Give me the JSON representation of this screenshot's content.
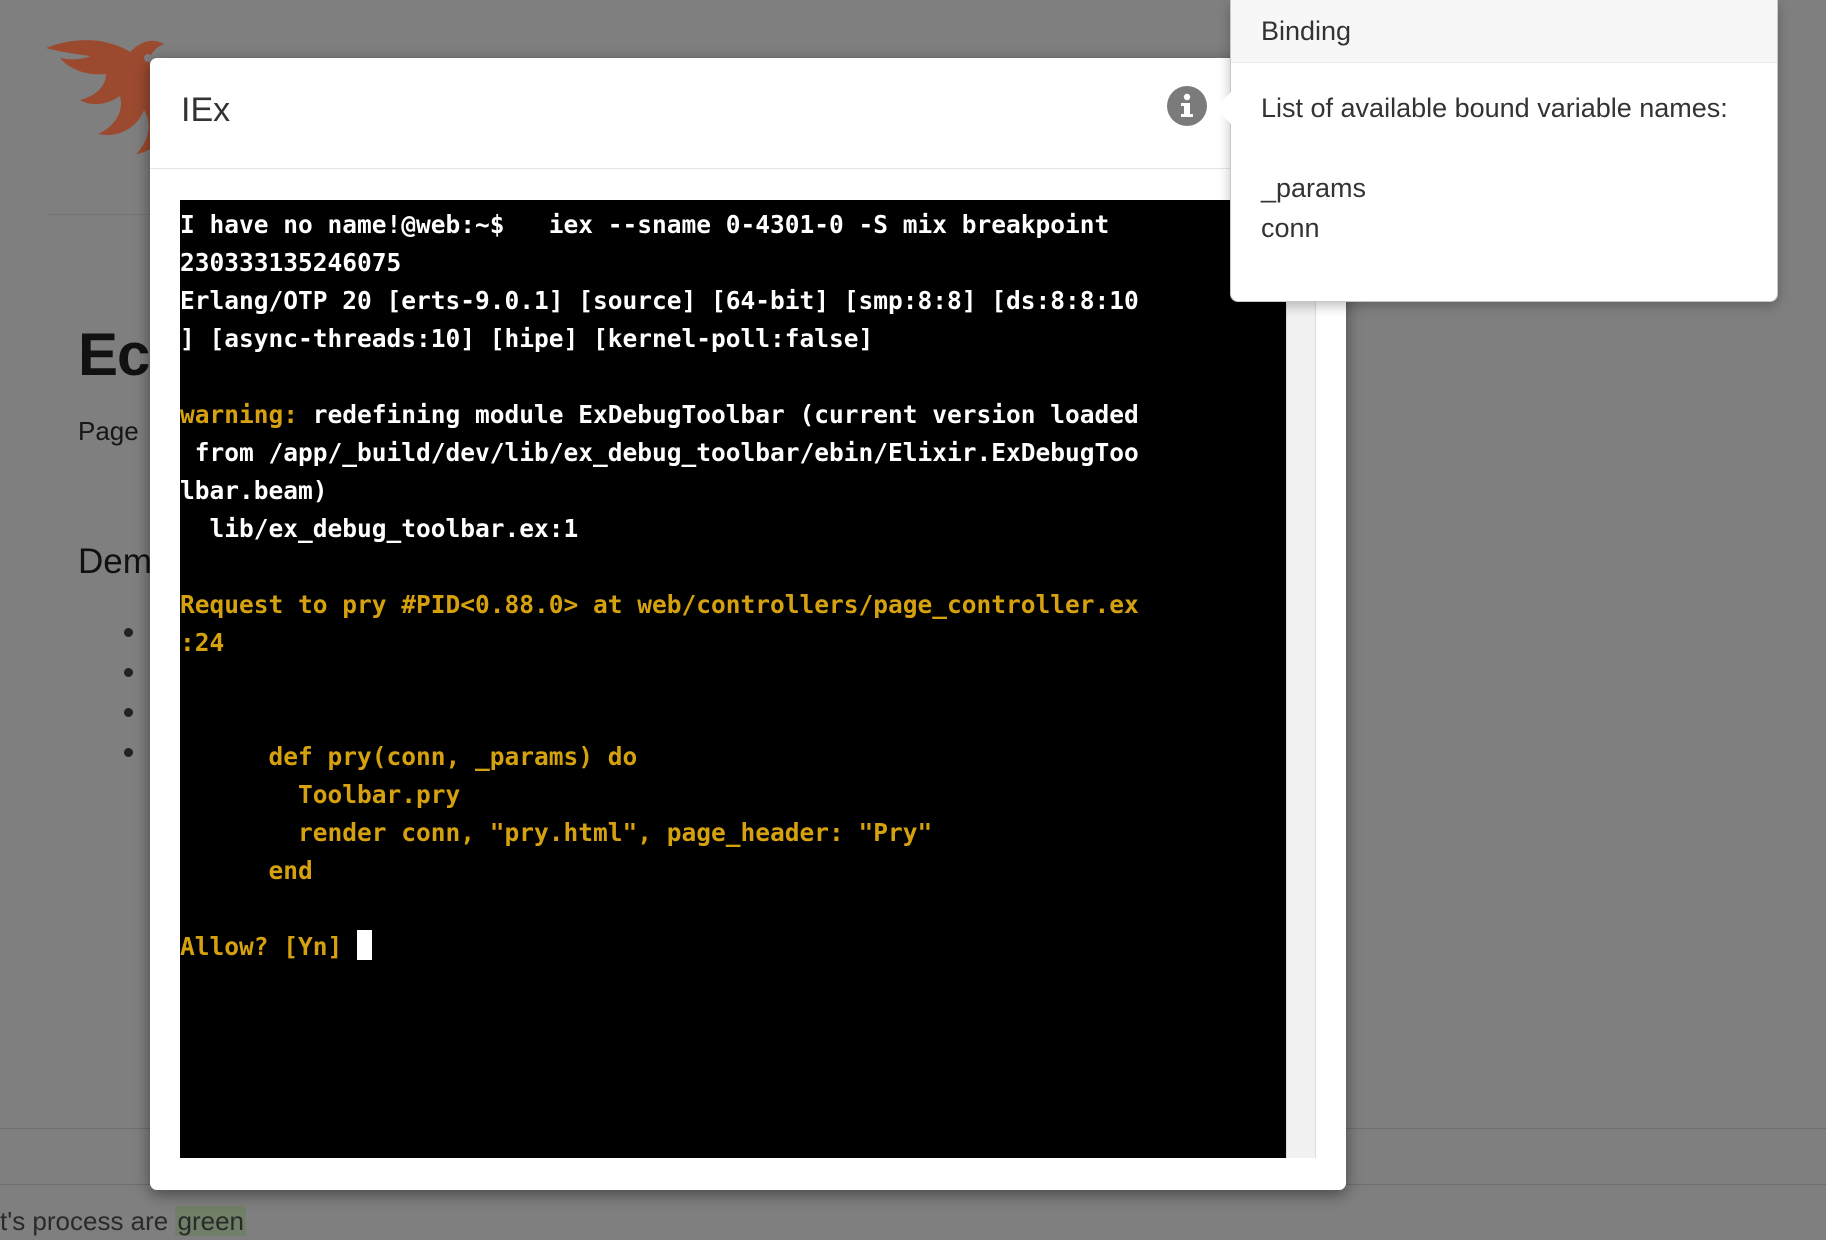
{
  "background_page": {
    "title": "Ec",
    "subtitle": "Page",
    "section_heading": "Dem",
    "bullet_count": 4,
    "footer_text": "t's process are ",
    "footer_highlight": "green",
    "logo_color": "#b94b2a"
  },
  "modal": {
    "title": "IEx",
    "info_icon": "info-icon"
  },
  "terminal": {
    "lines": [
      {
        "text": "I have no name!@web:~$   iex --sname 0-4301-0 -S mix breakpoint",
        "color": "white"
      },
      {
        "text": "230333135246075",
        "color": "white"
      },
      {
        "text": "Erlang/OTP 20 [erts-9.0.1] [source] [64-bit] [smp:8:8] [ds:8:8:10",
        "color": "white"
      },
      {
        "text": "] [async-threads:10] [hipe] [kernel-poll:false]",
        "color": "white"
      },
      {
        "text": "",
        "color": "white"
      },
      {
        "prefix": "warning:",
        "text": " redefining module ExDebugToolbar (current version loaded",
        "color": "white"
      },
      {
        "text": " from /app/_build/dev/lib/ex_debug_toolbar/ebin/Elixir.ExDebugToo",
        "color": "white"
      },
      {
        "text": "lbar.beam)",
        "color": "white"
      },
      {
        "text": "  lib/ex_debug_toolbar.ex:1",
        "color": "white"
      },
      {
        "text": "",
        "color": "white"
      },
      {
        "text": "Request to pry #PID<0.88.0> at web/controllers/page_controller.ex",
        "color": "yellow"
      },
      {
        "text": ":24",
        "color": "yellow"
      },
      {
        "text": "",
        "color": "white"
      },
      {
        "text": "",
        "color": "white"
      },
      {
        "text": "      def pry(conn, _params) do",
        "color": "yellow"
      },
      {
        "text": "        Toolbar.pry",
        "color": "yellow"
      },
      {
        "text": "        render conn, \"pry.html\", page_header: \"Pry\"",
        "color": "yellow"
      },
      {
        "text": "      end",
        "color": "yellow"
      },
      {
        "text": "",
        "color": "white"
      },
      {
        "text": "Allow? [Yn] ",
        "color": "yellow",
        "cursor": true
      }
    ],
    "text_color": "#ffffff",
    "accent_color": "#d6a10f",
    "background": "#000000"
  },
  "popover": {
    "title": "Binding",
    "description": "List of available bound variable names:",
    "variables": [
      "_params",
      "conn"
    ]
  }
}
